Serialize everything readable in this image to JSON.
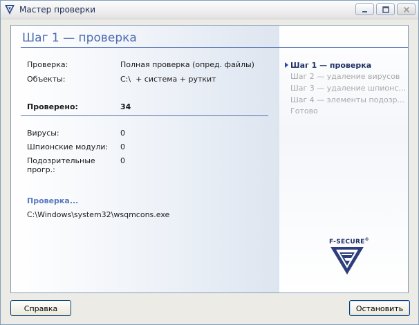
{
  "window": {
    "title": "Мастер проверки",
    "logo_icon": "fsecure-logo-icon",
    "controls": [
      "minimize-icon",
      "maximize-icon",
      "close-icon"
    ]
  },
  "main": {
    "heading": "Шаг 1 — проверка",
    "fields": [
      {
        "label": "Проверка:",
        "value": "Полная проверка (опред. файлы)"
      },
      {
        "label": "Объекты:",
        "value": "C:\\  + система + руткит"
      }
    ],
    "scanned": {
      "label": "Проверено:",
      "value": "34"
    },
    "results": [
      {
        "label": "Вирусы:",
        "value": "0"
      },
      {
        "label": "Шпионские модули:",
        "value": "0"
      },
      {
        "label": "Подозрительные",
        "label2": "прогр.:",
        "value": "0"
      }
    ],
    "progress": {
      "title": "Проверка...",
      "file": "C:\\Windows\\system32\\wsqmcons.exe"
    }
  },
  "steps": [
    {
      "label": "Шаг 1 — проверка",
      "active": true
    },
    {
      "label": "Шаг 2 — удаление вирусов",
      "active": false
    },
    {
      "label": "Шаг 3 — удаление шпионс...",
      "active": false
    },
    {
      "label": "Шаг 4 — элементы подозр...",
      "active": false
    },
    {
      "label": "Готово",
      "active": false
    }
  ],
  "brand": {
    "name": "F-SECURE",
    "mark": "®",
    "logo_icon": "fsecure-shield-icon"
  },
  "buttons": {
    "help": "Справка",
    "stop": "Остановить"
  },
  "colors": {
    "accent": "#4e6cb1",
    "step_active": "#1e2e64",
    "step_inactive": "#a8a8a8"
  }
}
